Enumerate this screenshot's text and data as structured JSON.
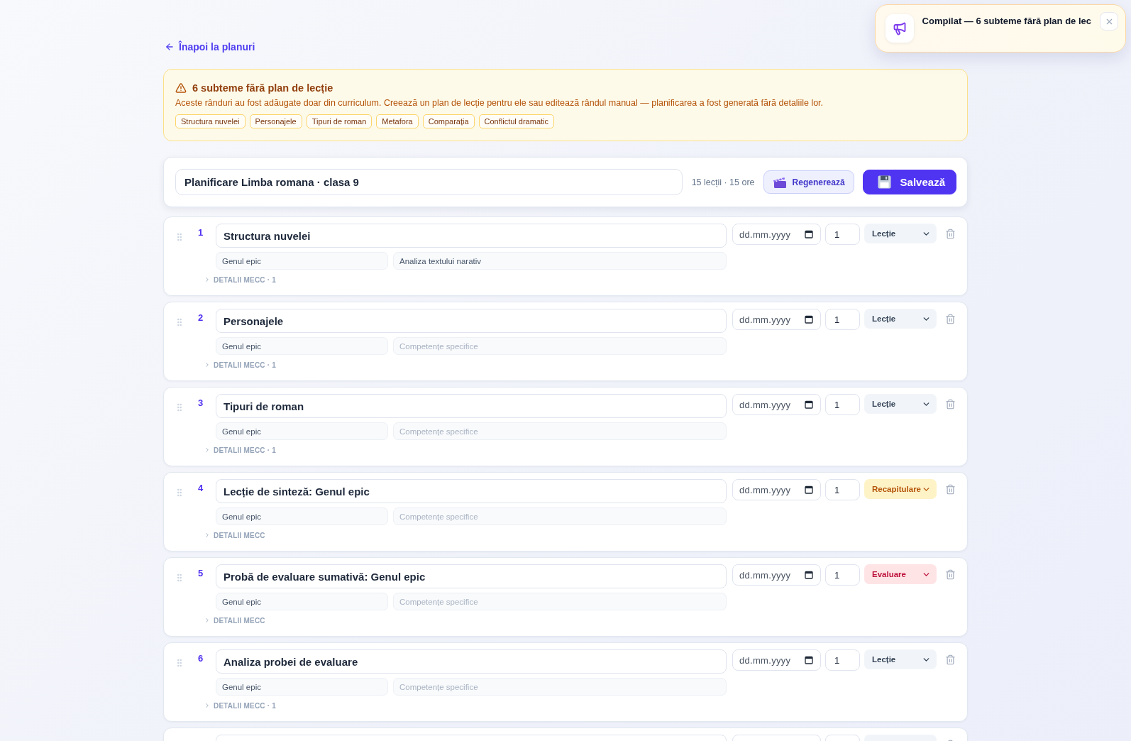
{
  "back_link": {
    "label": "Înapoi la planuri"
  },
  "warning": {
    "title": "6 subteme fără plan de lecție",
    "message": "Aceste rânduri au fost adăugate doar din curriculum. Creează un plan de lecție pentru ele sau editează rândul manual — planificarea a fost generată fără detaliile lor.",
    "tags": [
      "Structura nuvelei",
      "Personajele",
      "Tipuri de roman",
      "Metafora",
      "Comparația",
      "Conflictul dramatic"
    ]
  },
  "plan_header": {
    "title_field": {
      "value": "Planificare Limba romana · clasa 9"
    },
    "summary": "15 lecții · 15 ore",
    "buttons": [
      {
        "label": "Regenerează",
        "kind": "secondary"
      },
      {
        "label": "Salvează",
        "kind": "primary"
      }
    ]
  },
  "rows": [
    {
      "number": "1",
      "title": "Structura nuvelei",
      "field_1": {
        "value": "Genul epic"
      },
      "field_2": {
        "value": "Analiza textului narativ"
      },
      "date": {
        "placeholder": "dd.mm.yyyy"
      },
      "hours": "1",
      "type": {
        "label": "Lecție",
        "kind": "lesson"
      },
      "details": {
        "label": "DETALII MECC · 1",
        "expanded": false
      }
    },
    {
      "number": "2",
      "title": "Personajele",
      "field_1": {
        "value": "Genul epic"
      },
      "field_2": {
        "placeholder": "Competențe specifice"
      },
      "date": {
        "placeholder": "dd.mm.yyyy"
      },
      "hours": "1",
      "type": {
        "label": "Lecție",
        "kind": "lesson"
      },
      "details": {
        "label": "DETALII MECC · 1",
        "expanded": false
      }
    },
    {
      "number": "3",
      "title": "Tipuri de roman",
      "field_1": {
        "value": "Genul epic"
      },
      "field_2": {
        "placeholder": "Competențe specifice"
      },
      "date": {
        "placeholder": "dd.mm.yyyy"
      },
      "hours": "1",
      "type": {
        "label": "Lecție",
        "kind": "lesson"
      },
      "details": {
        "label": "DETALII MECC · 1",
        "expanded": false
      }
    },
    {
      "number": "4",
      "title": "Lecție de sinteză: Genul epic",
      "field_1": {
        "value": "Genul epic"
      },
      "field_2": {
        "placeholder": "Competențe specifice"
      },
      "date": {
        "placeholder": "dd.mm.yyyy"
      },
      "hours": "1",
      "type": {
        "label": "Recapitulare",
        "kind": "recap"
      },
      "details": {
        "label": "DETALII MECC",
        "expanded": false
      }
    },
    {
      "number": "5",
      "title": "Probă de evaluare sumativă: Genul epic",
      "field_1": {
        "value": "Genul epic"
      },
      "field_2": {
        "placeholder": "Competențe specifice"
      },
      "date": {
        "placeholder": "dd.mm.yyyy"
      },
      "hours": "1",
      "type": {
        "label": "Evaluare",
        "kind": "evaluation"
      },
      "details": {
        "label": "DETALII MECC",
        "expanded": false
      }
    },
    {
      "number": "6",
      "title": "Analiza probei de evaluare",
      "field_1": {
        "value": "Genul epic"
      },
      "field_2": {
        "placeholder": "Competențe specifice"
      },
      "date": {
        "placeholder": "dd.mm.yyyy"
      },
      "hours": "1",
      "type": {
        "label": "Lecție",
        "kind": "lesson"
      },
      "details": {
        "label": "DETALII MECC · 1",
        "expanded": false
      }
    },
    {
      "type": {
        "kind": "lesson"
      }
    }
  ],
  "toast": {
    "message": "Compilat — 6 subteme fără plan de lec"
  }
}
